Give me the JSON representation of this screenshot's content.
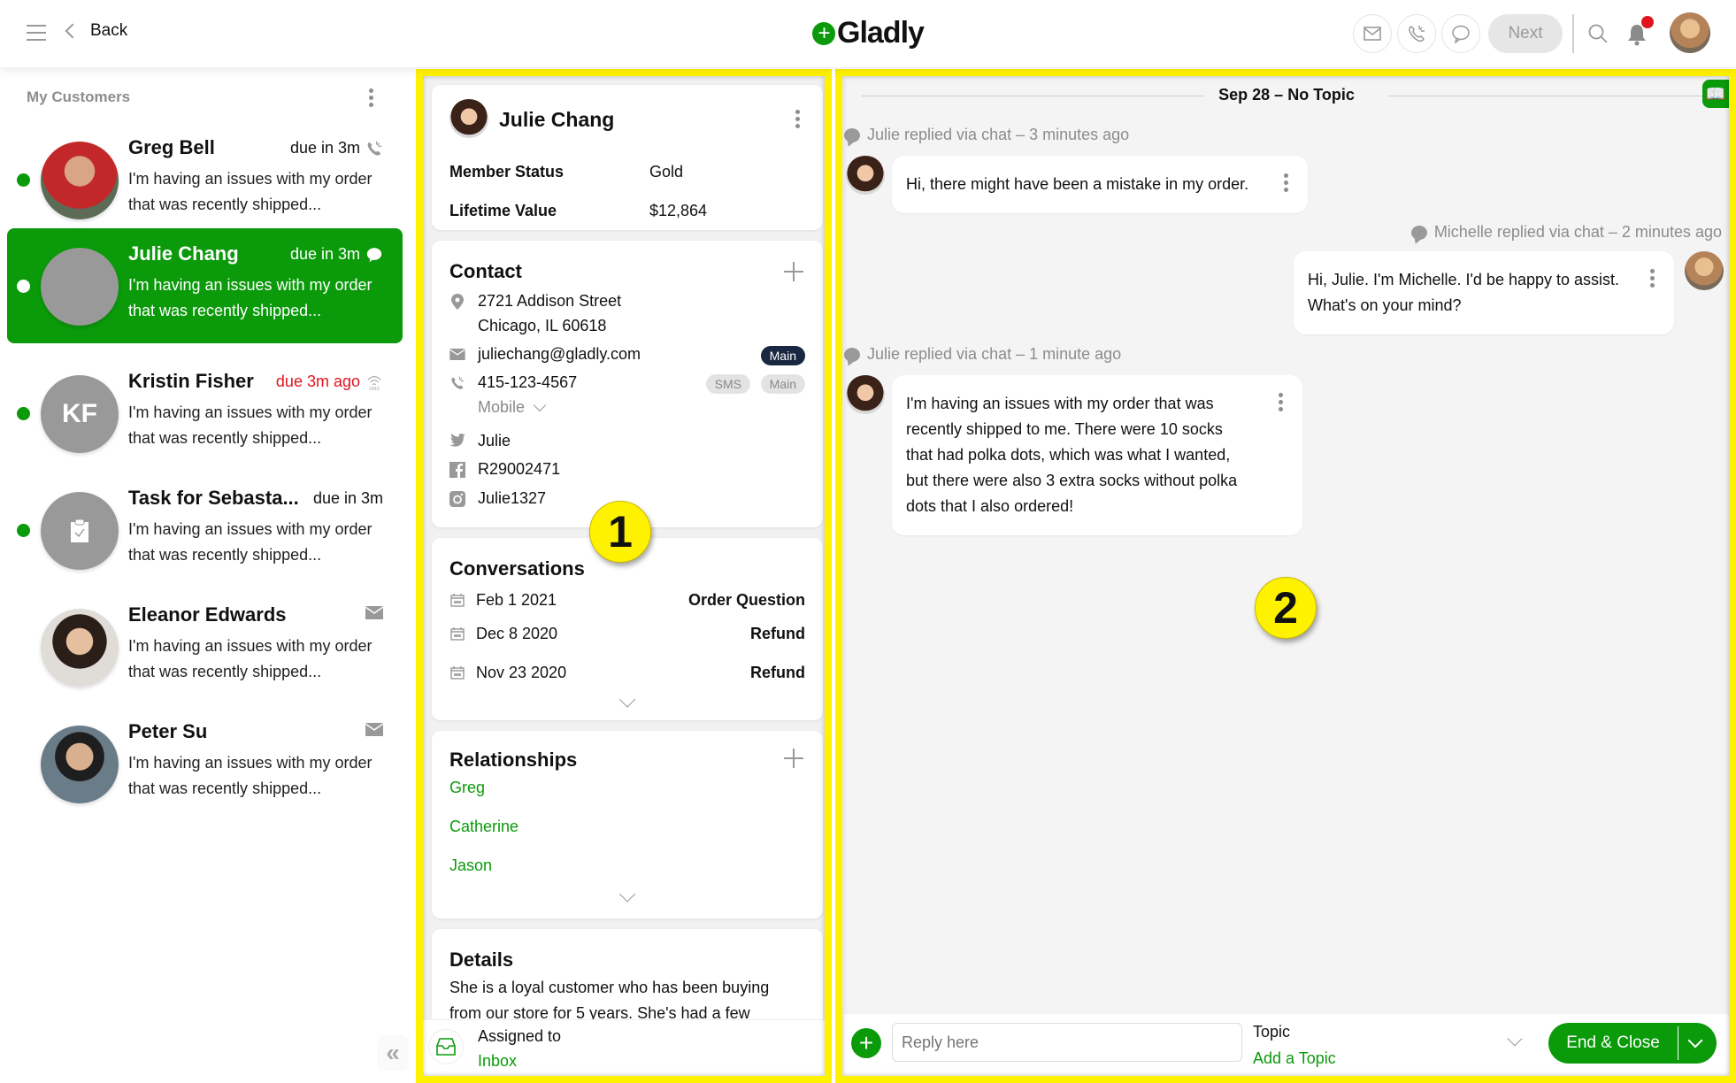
{
  "header": {
    "back_label": "Back",
    "brand": "Gladly",
    "next_label": "Next",
    "icons": [
      "menu-icon",
      "chevron-left-icon",
      "email-icon",
      "phone-icon",
      "chat-icon",
      "search-icon",
      "bell-icon"
    ],
    "notification_dot_color": "#e0141e"
  },
  "sidebar": {
    "title": "My Customers",
    "collapse_label": "«",
    "customers": [
      {
        "name": "Greg Bell",
        "due": "due in 3m",
        "channel": "phone",
        "preview": "I'm having an issues with my order that was recently shipped...",
        "online": true,
        "selected": false,
        "initials": ""
      },
      {
        "name": "Julie Chang",
        "due": "due in 3m",
        "channel": "chat",
        "preview": "I'm having an issues with my order that was recently shipped...",
        "online": true,
        "selected": true,
        "initials": ""
      },
      {
        "name": "Kristin Fisher",
        "due": "due 3m ago",
        "channel": "sms",
        "preview": "I'm having an issues with my order that was recently shipped...",
        "online": true,
        "selected": false,
        "overdue": true,
        "initials": "KF"
      },
      {
        "name": "Task for Sebasta...",
        "due": "due in 3m",
        "channel": "task",
        "preview": "I'm having an issues with my order that was recently shipped...",
        "online": true,
        "selected": false,
        "initials": ""
      },
      {
        "name": "Eleanor Edwards",
        "due": "",
        "channel": "email",
        "preview": "I'm having an issues with my order that was recently shipped...",
        "online": false,
        "selected": false,
        "initials": ""
      },
      {
        "name": "Peter Su",
        "due": "",
        "channel": "email",
        "preview": "I'm having an issues with my order that was recently shipped...",
        "online": false,
        "selected": false,
        "initials": ""
      }
    ]
  },
  "profile": {
    "name": "Julie Chang",
    "fields": [
      {
        "label": "Member Status",
        "value": "Gold"
      },
      {
        "label": "Lifetime Value",
        "value": "$12,864"
      }
    ],
    "contact": {
      "title": "Contact",
      "address_line1": "2721 Addison Street",
      "address_line2": "Chicago, IL 60618",
      "email": "juliechang@gladly.com",
      "email_tag": "Main",
      "phone": "415-123-4567",
      "phone_tags": [
        "SMS",
        "Main"
      ],
      "phone_type": "Mobile",
      "twitter": "Julie",
      "facebook": "R29002471",
      "instagram": "Julie1327"
    },
    "conversations": {
      "title": "Conversations",
      "items": [
        {
          "date": "Feb 1 2021",
          "topic": "Order Question"
        },
        {
          "date": "Dec 8 2020",
          "topic": "Refund"
        },
        {
          "date": "Nov 23 2020",
          "topic": "Refund"
        }
      ]
    },
    "relationships": {
      "title": "Relationships",
      "items": [
        "Greg",
        "Catherine",
        "Jason"
      ]
    },
    "details": {
      "title": "Details",
      "text": "She is a loyal customer who has been buying from our store for 5 years. She's had a few"
    },
    "assigned": {
      "label": "Assigned to",
      "value": "Inbox"
    }
  },
  "conversation": {
    "date_header": "Sep 28 – No Topic",
    "messages": [
      {
        "meta": "Julie replied via chat – 3 minutes ago",
        "text": "Hi, there might have been a mistake in my order.",
        "side": "left"
      },
      {
        "meta": "Michelle replied via chat – 2 minutes ago",
        "text": "Hi, Julie. I'm Michelle. I'd be happy to assist. What's on your mind?",
        "side": "right"
      },
      {
        "meta": "Julie replied via chat – 1 minute ago",
        "text": "I'm having an issues with my order that was recently shipped to me. There were 10 socks that had polka dots, which was what I wanted, but there were also 3 extra socks without polka dots that I also ordered!",
        "side": "left"
      }
    ],
    "composer": {
      "placeholder": "Reply here",
      "topic_label": "Topic",
      "topic_value": "Add a Topic",
      "end_close_label": "End & Close"
    }
  },
  "annotations": [
    "1",
    "2"
  ],
  "colors": {
    "brand_green": "#0a9a0a",
    "highlight_yellow": "#fff200",
    "overdue_red": "#e0141e",
    "tag_dark": "#1a2740"
  }
}
